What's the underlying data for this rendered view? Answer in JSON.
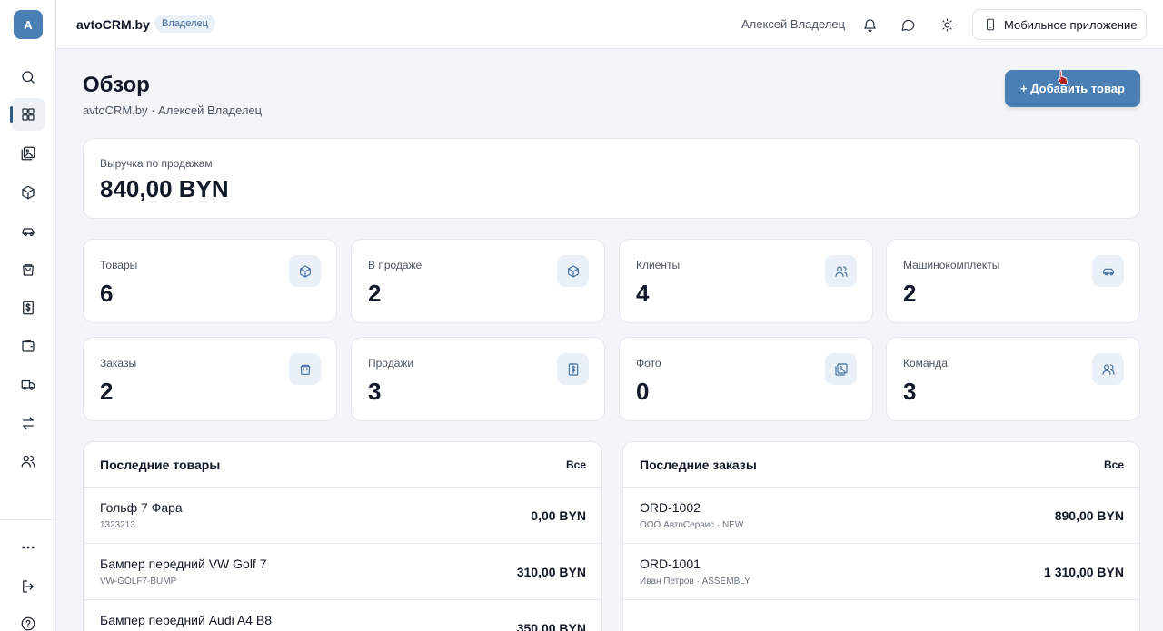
{
  "sidebar": {
    "avatar_letter": "А",
    "items": [
      {
        "icon": "search-icon"
      },
      {
        "icon": "dashboard-icon"
      },
      {
        "icon": "photos-icon"
      },
      {
        "icon": "box-icon"
      },
      {
        "icon": "car-icon"
      },
      {
        "icon": "shopping-bag-icon"
      },
      {
        "icon": "dollar-receipt-icon"
      },
      {
        "icon": "wallet-icon"
      },
      {
        "icon": "truck-icon"
      },
      {
        "icon": "transfer-icon"
      },
      {
        "icon": "users-icon"
      },
      {
        "icon": "more-icon"
      },
      {
        "icon": "logout-icon"
      },
      {
        "icon": "help-icon"
      }
    ]
  },
  "topbar": {
    "brand": "avtoCRM.by",
    "role": "Владелец",
    "user_name": "Алексей Владелец",
    "mobile_app_label": "Мобильное приложение"
  },
  "header": {
    "title": "Обзор",
    "subtitle": "avtoCRM.by · Алексей Владелец",
    "add_button_label": "+ Добавить товар"
  },
  "revenue": {
    "label": "Выручка по продажам",
    "value": "840,00 BYN"
  },
  "stats": [
    {
      "label": "Товары",
      "value": "6",
      "icon": "box-icon"
    },
    {
      "label": "В продаже",
      "value": "2",
      "icon": "box-icon"
    },
    {
      "label": "Клиенты",
      "value": "4",
      "icon": "users-icon"
    },
    {
      "label": "Машинокомплекты",
      "value": "2",
      "icon": "car-icon"
    },
    {
      "label": "Заказы",
      "value": "2",
      "icon": "shopping-bag-icon"
    },
    {
      "label": "Продажи",
      "value": "3",
      "icon": "dollar-receipt-icon"
    },
    {
      "label": "Фото",
      "value": "0",
      "icon": "photos-icon"
    },
    {
      "label": "Команда",
      "value": "3",
      "icon": "users-icon"
    }
  ],
  "recent_products": {
    "title": "Последние товары",
    "all_label": "Все",
    "items": [
      {
        "name": "Гольф 7 Фара",
        "sku": "1323213",
        "price": "0,00 BYN"
      },
      {
        "name": "Бампер передний VW Golf 7",
        "sku": "VW-GOLF7-BUMP",
        "price": "310,00 BYN"
      },
      {
        "name": "Бампер передний Audi A4 B8",
        "sku": "",
        "price": "350,00 BYN"
      }
    ]
  },
  "recent_orders": {
    "title": "Последние заказы",
    "all_label": "Все",
    "items": [
      {
        "number": "ORD-1002",
        "meta": "ООО АвтоСервис · NEW",
        "amount": "890,00 BYN"
      },
      {
        "number": "ORD-1001",
        "meta": "Иван Петров · ASSEMBLY",
        "amount": "1 310,00 BYN"
      }
    ]
  },
  "colors": {
    "accent": "#4a7fb5",
    "badge_bg": "#e9f0f8",
    "page_bg": "#f3f5f8"
  }
}
